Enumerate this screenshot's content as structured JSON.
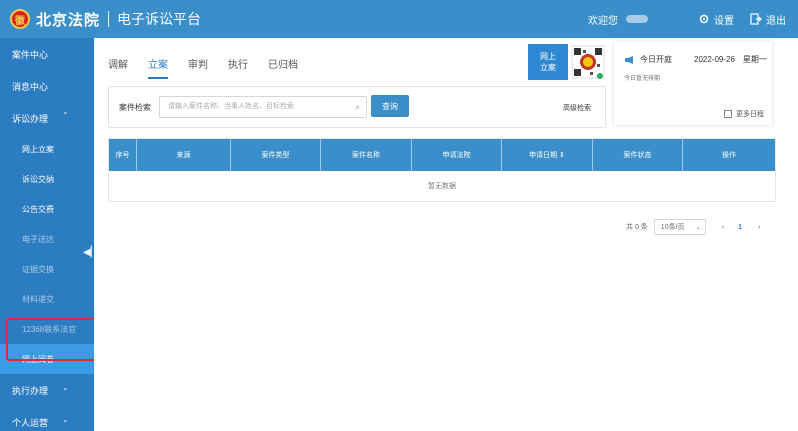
{
  "header": {
    "logo_glyph": "徽",
    "court_name": "北京法院",
    "platform_name": "电子诉讼平台",
    "welcome": "欢迎您",
    "settings_label": "设置",
    "logout_label": "退出"
  },
  "sidebar": {
    "items": [
      {
        "label": "案件中心"
      },
      {
        "label": "消息中心"
      },
      {
        "label": "诉讼办理",
        "chevron": "⌃"
      }
    ],
    "sub_items": [
      {
        "label": "网上立案"
      },
      {
        "label": "诉讼交纳"
      },
      {
        "label": "公告交费"
      },
      {
        "label": "电子送达"
      },
      {
        "label": "证据交换"
      },
      {
        "label": "材料递交"
      },
      {
        "label": "12368联系法官"
      },
      {
        "label": "网上阅卷"
      }
    ],
    "bottom_items": [
      {
        "label": "执行办理",
        "chevron": "⌄"
      },
      {
        "label": "个人运营",
        "chevron": "⌄"
      }
    ]
  },
  "tabs": [
    "调解",
    "立案",
    "审判",
    "执行",
    "已归档"
  ],
  "online_filing": "网上\n立案",
  "today": {
    "title": "今日开庭",
    "date": "2022-09-26",
    "weekday": "星期一",
    "empty": "今日暂无排期",
    "more_label": "更多日程"
  },
  "search": {
    "label": "案件检索",
    "placeholder": "请输入案件名称、当事人姓名、目标检索",
    "query_label": "查询",
    "advanced_label": "高级检索"
  },
  "table": {
    "columns": [
      "序号",
      "来源",
      "案件类型",
      "案件名称",
      "申请法院",
      "申请日期 ⇕",
      "案件状态",
      "操作"
    ],
    "empty_text": "暂无数据"
  },
  "pagination": {
    "total": "共 0 条",
    "page_size": "10条/页",
    "prev": "‹",
    "current": "1",
    "next": "›"
  },
  "colors": {
    "primary": "#3a8ec9",
    "sidebar": "#2b7cc0",
    "highlight": "#d9302b"
  }
}
